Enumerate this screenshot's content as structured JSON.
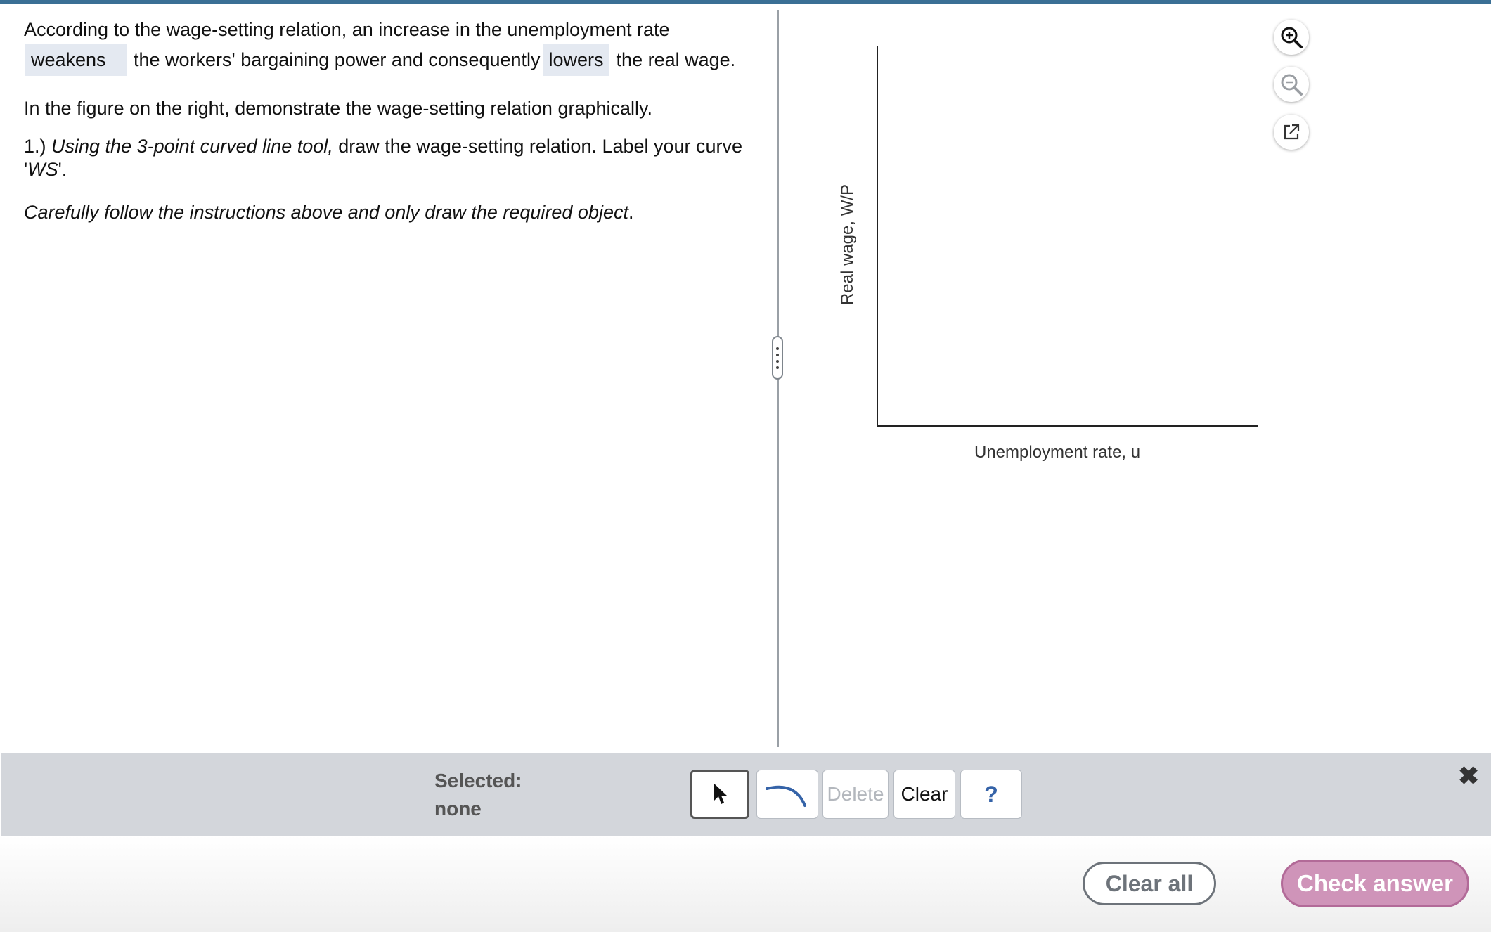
{
  "question": {
    "line1": "According to the wage-setting relation, an increase in the unemployment rate",
    "answer1": "weakens",
    "middle": "the workers' bargaining power and consequently",
    "answer2": "lowers",
    "end": "the real wage.",
    "para2": "In the figure on the right, demonstrate the wage-setting relation graphically.",
    "step_prefix": "1.) ",
    "step_italic": "Using the 3-point curved line tool,",
    "step_rest": " draw the wage-setting relation. Label your curve",
    "step_label_open": "'",
    "step_label": "WS",
    "step_label_close": "'.",
    "instruction_italic": "Carefully follow the instructions above and only draw the required object",
    "instruction_end": "."
  },
  "graph": {
    "y_label": "Real wage, W/P",
    "x_label": "Unemployment rate, u"
  },
  "icons": {
    "zoom_in": "zoom-in-icon",
    "zoom_out": "zoom-out-icon",
    "popout": "external-link-icon",
    "pointer": "pointer-arrow-icon",
    "curve": "curve-tool-icon",
    "close": "close-icon"
  },
  "toolbar": {
    "selected_title": "Selected:",
    "selected_value": "none",
    "delete_label": "Delete",
    "clear_label": "Clear",
    "help_label": "?",
    "close_symbol": "✖"
  },
  "footer": {
    "clear_all_label": "Clear all",
    "check_answer_label": "Check answer"
  },
  "colors": {
    "accent_bar": "#3a6f95",
    "answer_highlight": "#e4e9f1",
    "check_button": "#cf94b9",
    "curve_tool": "#3563a8"
  }
}
